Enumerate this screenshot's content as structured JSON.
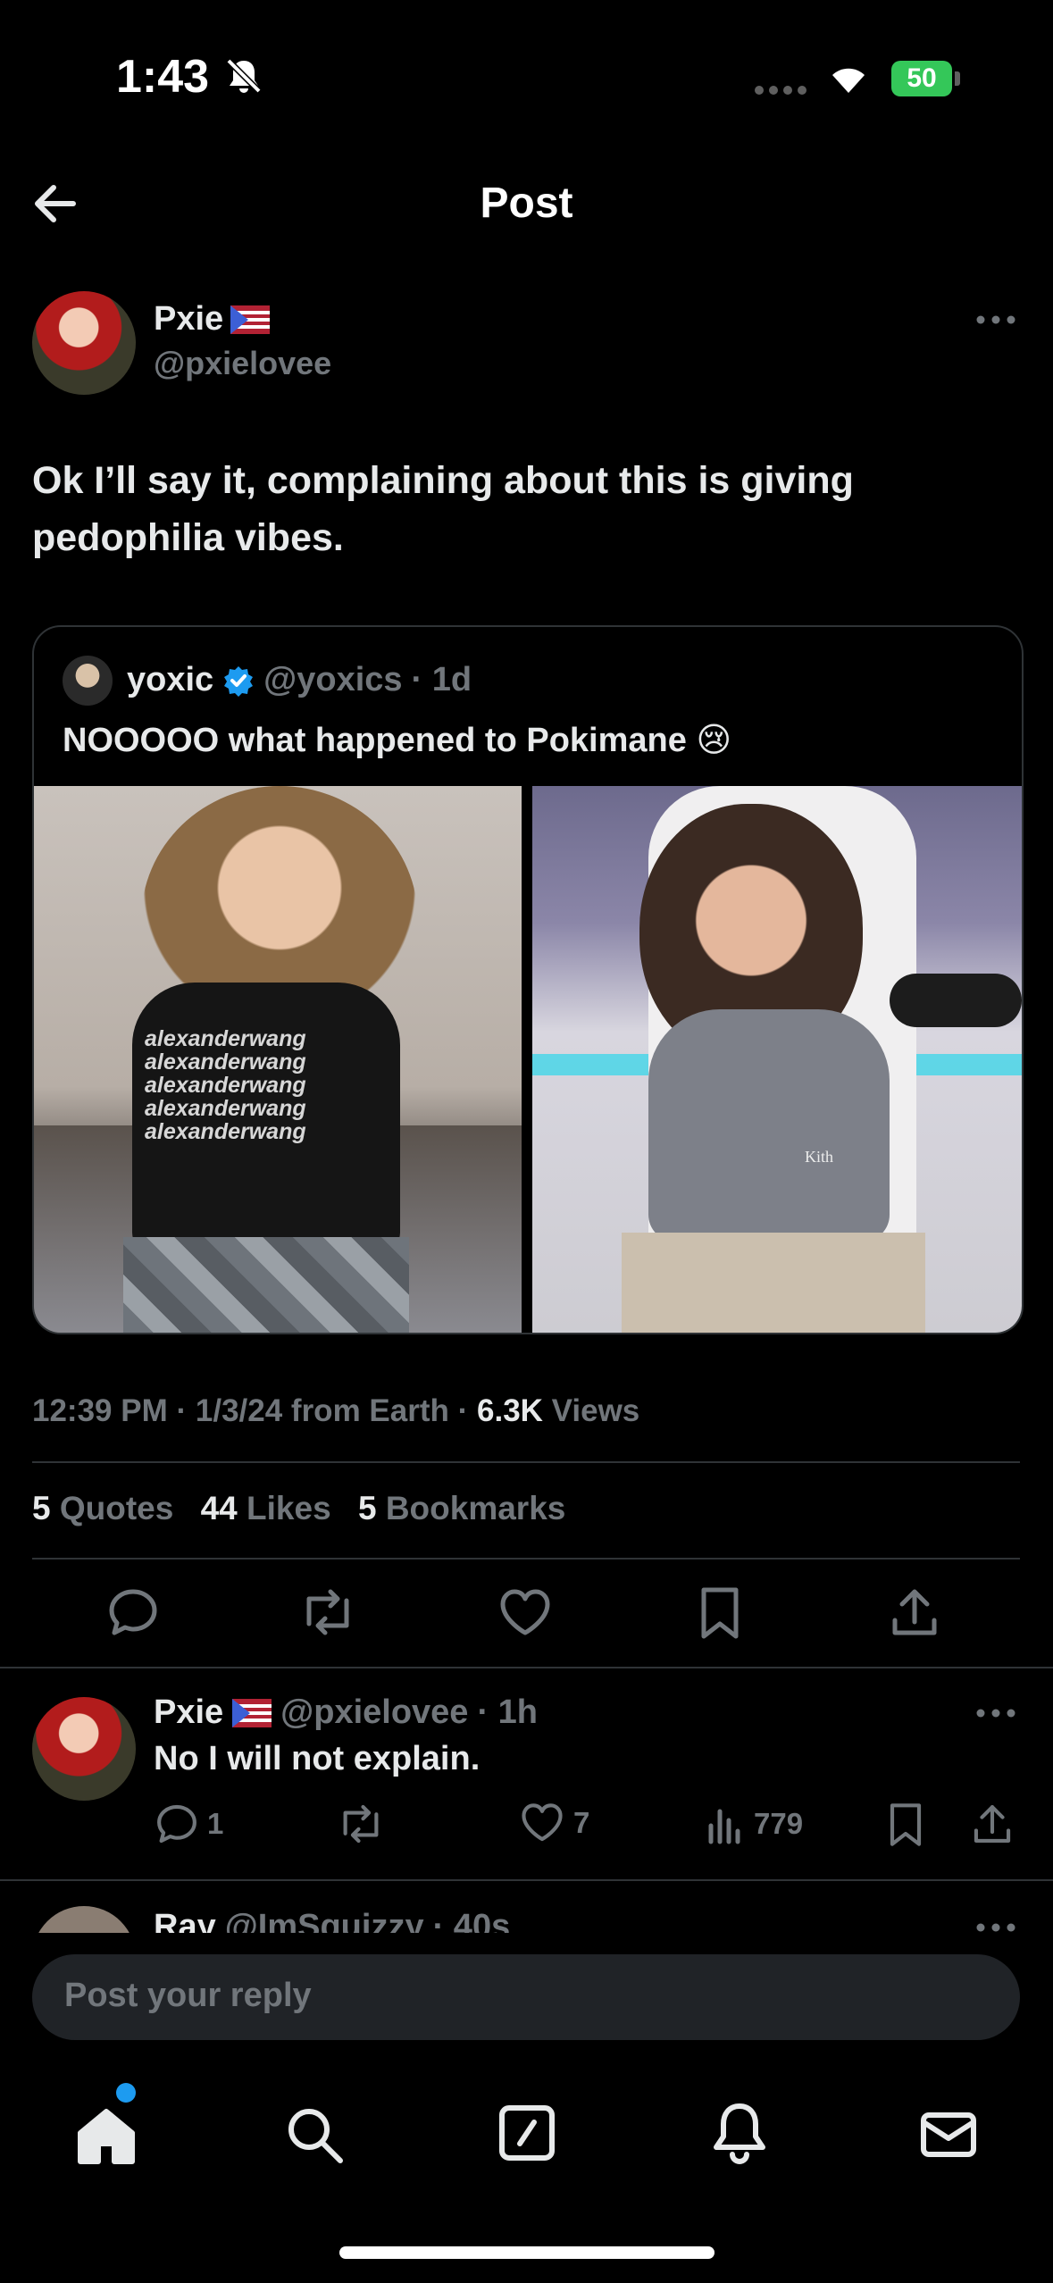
{
  "status_bar": {
    "time": "1:43",
    "battery": "50"
  },
  "header": {
    "title": "Post"
  },
  "post": {
    "author_name": "Pxie",
    "author_handle": "@pxielovee",
    "text_line1": "Ok I’ll say it, complaining about this is giving",
    "text_line2": "pedophilia vibes."
  },
  "quoted_post": {
    "author_name": "yoxic",
    "author_handle": "@yoxics",
    "time": "· 1d",
    "text": "NOOOOO what happened to Pokimane",
    "emoji": "😢",
    "shirt_text": "alexanderwang",
    "shirt_brand": "Kith"
  },
  "meta": {
    "time": "12:39 PM",
    "date": "1/3/24 from Earth",
    "views_count": "6.3K",
    "views_label": "Views"
  },
  "engagement": {
    "quotes_count": "5",
    "quotes_label": "Quotes",
    "likes_count": "44",
    "likes_label": "Likes",
    "bookmarks_count": "5",
    "bookmarks_label": "Bookmarks"
  },
  "reply": {
    "author_name": "Pxie",
    "author_handle": "@pxielovee",
    "time": "· 1h",
    "text": "No I will not explain.",
    "reply_count": "1",
    "like_count": "7",
    "view_count": "779"
  },
  "next_reply": {
    "author_name": "Ray",
    "author_handle": "@ImSquizzy",
    "time": "· 40s"
  },
  "composer": {
    "placeholder": "Post your reply"
  },
  "colors": {
    "accent": "#1d9bf0",
    "muted": "#71767b",
    "battery": "#34c759"
  },
  "icons": [
    "back-arrow-icon",
    "more-icon",
    "verified-icon",
    "reply-icon",
    "repost-icon",
    "like-icon",
    "bookmark-icon",
    "share-icon",
    "views-icon",
    "home-icon",
    "search-icon",
    "compose-icon",
    "bell-icon",
    "mail-icon",
    "flag-icon",
    "wifi-icon",
    "mute-icon"
  ]
}
